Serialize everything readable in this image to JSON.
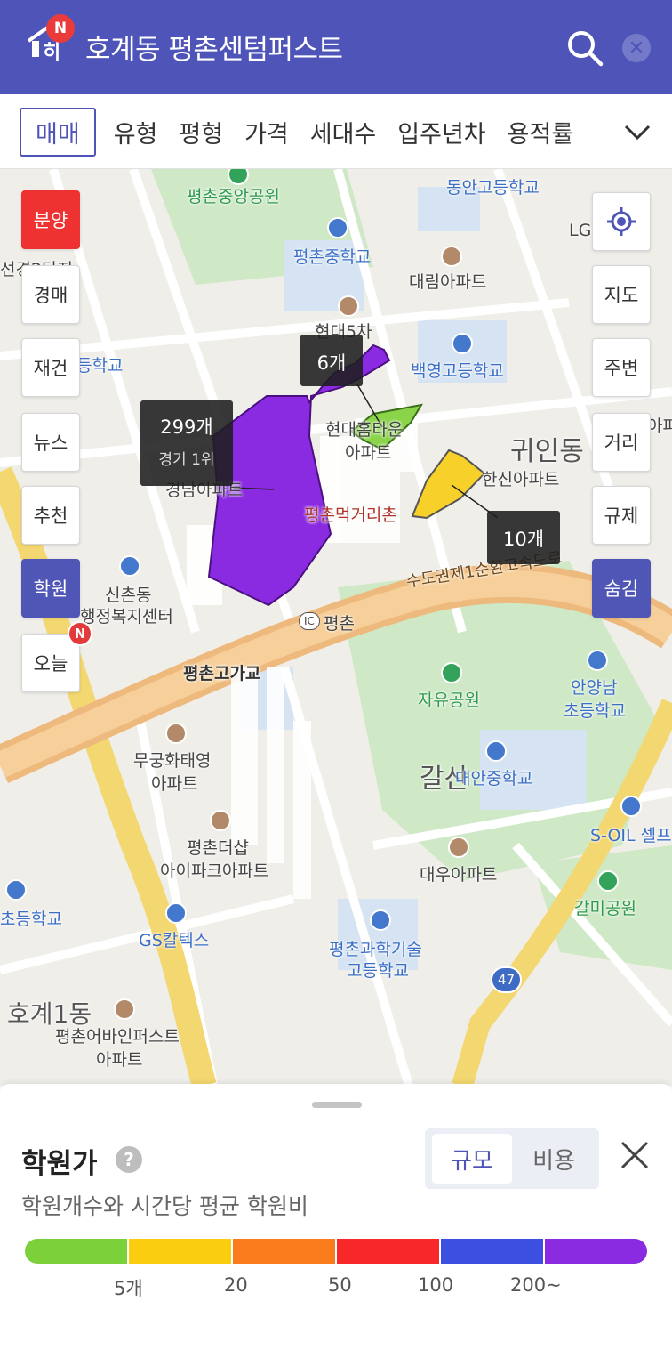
{
  "header": {
    "title": "호계동 평촌센텀퍼스트",
    "logo_badge": "N"
  },
  "filters": {
    "items": [
      "매매",
      "유형",
      "평형",
      "가격",
      "세대수",
      "입주년차",
      "용적률"
    ]
  },
  "left_buttons": [
    "분양",
    "경매",
    "재건",
    "뉴스",
    "추천",
    "학원",
    "오늘"
  ],
  "left_badge": "N",
  "right_buttons": [
    "지도",
    "주변",
    "거리",
    "규제",
    "숨김"
  ],
  "map": {
    "labels": {
      "park_central": "평촌중앙공원",
      "donggan_high": "동안고등학교",
      "pyeongchon_middle": "평촌중학교",
      "daerim_apt": "대림아파트",
      "hyundai5": "현대5차",
      "baekyoung_high": "백영고등학교",
      "hyundai_apt": "현대홈타운",
      "apt_word": "아파트",
      "gwinin_dong": "귀인동",
      "hanshin_apt": "한신아파트",
      "food_street": "평촌먹거리촌",
      "expressway": "수도권제1순환고속도로",
      "gyeongnam_apt": "경남아파트",
      "sinchon_office": "신촌동",
      "welfare_center": "행정복지센터",
      "pyeongchon_ic": "평촌",
      "ic": "IC",
      "gogagyo": "평촌고가교",
      "jayu_park": "자유공원",
      "anyangnam": "안양남",
      "elementary": "초등학교",
      "mugung_apt": "무궁화태영",
      "galsan": "갈산",
      "daean_middle": "대안중학교",
      "soil": "S-OIL 셀프",
      "pyeongchon_the_sharp": "평촌더샵",
      "ipark_apt": "아이파크아파트",
      "daewoo_apt": "대우아파트",
      "galmi_park": "갈미공원",
      "elementary_left": "초등학교",
      "gs_caltex": "GS칼텍스",
      "science_high1": "평촌과학기술",
      "science_high2": "고등학교",
      "route47": "47",
      "hogye1": "호계1동",
      "avenue_first": "평촌어바인퍼스트",
      "lg": "LG",
      "left_top_label": "선경2단지",
      "left_school": "등학교",
      "left_apt": "아파"
    },
    "tags": [
      {
        "count": "299개",
        "sub": "경기 1위"
      },
      {
        "count": "6개"
      },
      {
        "count": "10개"
      }
    ],
    "zone_colors": {
      "purple": "#8a2be2",
      "green": "#8bd44a",
      "yellow": "#f7d02a"
    }
  },
  "sheet": {
    "title": "학원가",
    "help_icon": "?",
    "subtitle": "학원개수와 시간당 평균 학원비",
    "segment": {
      "on": "규모",
      "off": "비용"
    },
    "scale_colors": [
      "#7cd13a",
      "#fbcd0f",
      "#fb7c1c",
      "#f7272a",
      "#3d4fe0",
      "#8a2be2"
    ],
    "scale_ticks": [
      "5개",
      "20",
      "50",
      "100",
      "200~"
    ]
  }
}
